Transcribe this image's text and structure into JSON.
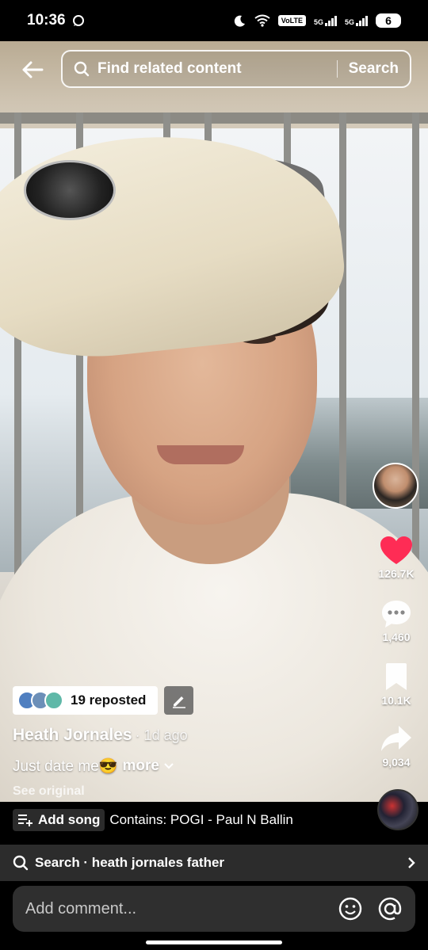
{
  "status": {
    "time": "10:36",
    "volte": "VoLTE",
    "net1": "5G",
    "net2": "5G",
    "battery": "6"
  },
  "header": {
    "search_placeholder": "Find related content",
    "search_button": "Search"
  },
  "actions": {
    "likes": "126.7K",
    "comments": "1,460",
    "saves": "10.1K",
    "shares": "9,034",
    "like_color": "#fe2c55"
  },
  "post": {
    "reposted_text": "19 reposted",
    "author": "Heath Jornales",
    "posted_ago": "· 1d ago",
    "caption": "Just date me😎",
    "more_label": "more",
    "see_original": "See original"
  },
  "music": {
    "add_song_label": "Add song",
    "contains": "Contains: POGI - Paul N Ballin"
  },
  "suggestion": {
    "text": "Search · heath jornales father"
  },
  "comment": {
    "placeholder": "Add comment..."
  }
}
